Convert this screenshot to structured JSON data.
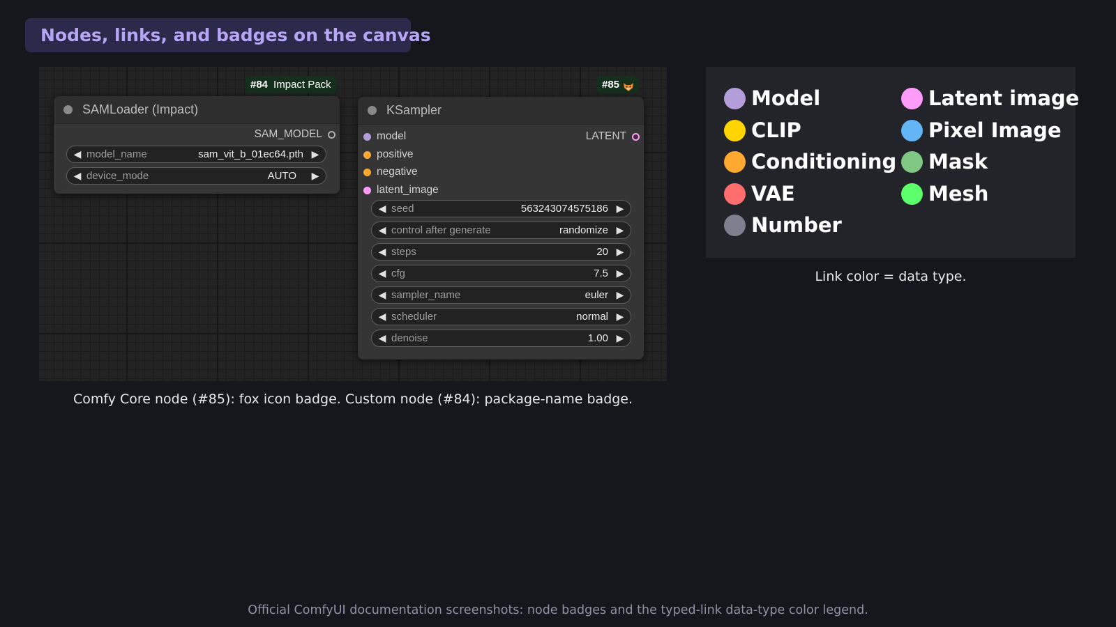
{
  "page": {
    "title": "Nodes, links, and badges on the canvas",
    "canvas_caption": "Comfy Core node (#85): fox icon badge. Custom node (#84): package-name badge.",
    "legend_caption": "Link color = data type.",
    "footer": "Official ComfyUI documentation screenshots: node badges and the typed-link data-type color legend."
  },
  "nodes": {
    "samloader": {
      "badge_id": "#84",
      "badge_package": "Impact Pack",
      "title": "SAMLoader (Impact)",
      "output": "SAM_MODEL",
      "widgets": [
        {
          "label": "model_name",
          "value": "sam_vit_b_01ec64.pth"
        },
        {
          "label": "device_mode",
          "value": "AUTO"
        }
      ]
    },
    "ksampler": {
      "badge_id": "#85",
      "badge_icon": "fox-icon",
      "title": "KSampler",
      "inputs": [
        {
          "label": "model",
          "color": "#b39ddb"
        },
        {
          "label": "positive",
          "color": "#ffa931"
        },
        {
          "label": "negative",
          "color": "#ffa931"
        },
        {
          "label": "latent_image",
          "color": "#ff9cf9"
        }
      ],
      "output": {
        "label": "LATENT",
        "color": "#ff9cf9"
      },
      "widgets": [
        {
          "label": "seed",
          "value": "563243074575186"
        },
        {
          "label": "control after generate",
          "value": "randomize"
        },
        {
          "label": "steps",
          "value": "20"
        },
        {
          "label": "cfg",
          "value": "7.5"
        },
        {
          "label": "sampler_name",
          "value": "euler"
        },
        {
          "label": "scheduler",
          "value": "normal"
        },
        {
          "label": "denoise",
          "value": "1.00"
        }
      ]
    }
  },
  "legend": [
    {
      "label": "Model",
      "color": "#b39ddb"
    },
    {
      "label": "Latent image",
      "color": "#ff9cf9"
    },
    {
      "label": "CLIP",
      "color": "#ffd500"
    },
    {
      "label": "Pixel Image",
      "color": "#64b5f6"
    },
    {
      "label": "Conditioning",
      "color": "#ffa931"
    },
    {
      "label": "Mask",
      "color": "#81c784"
    },
    {
      "label": "VAE",
      "color": "#ff6e6e"
    },
    {
      "label": "Mesh",
      "color": "#5dff6c"
    },
    {
      "label": "Number",
      "color": "#7f7f8f"
    }
  ]
}
